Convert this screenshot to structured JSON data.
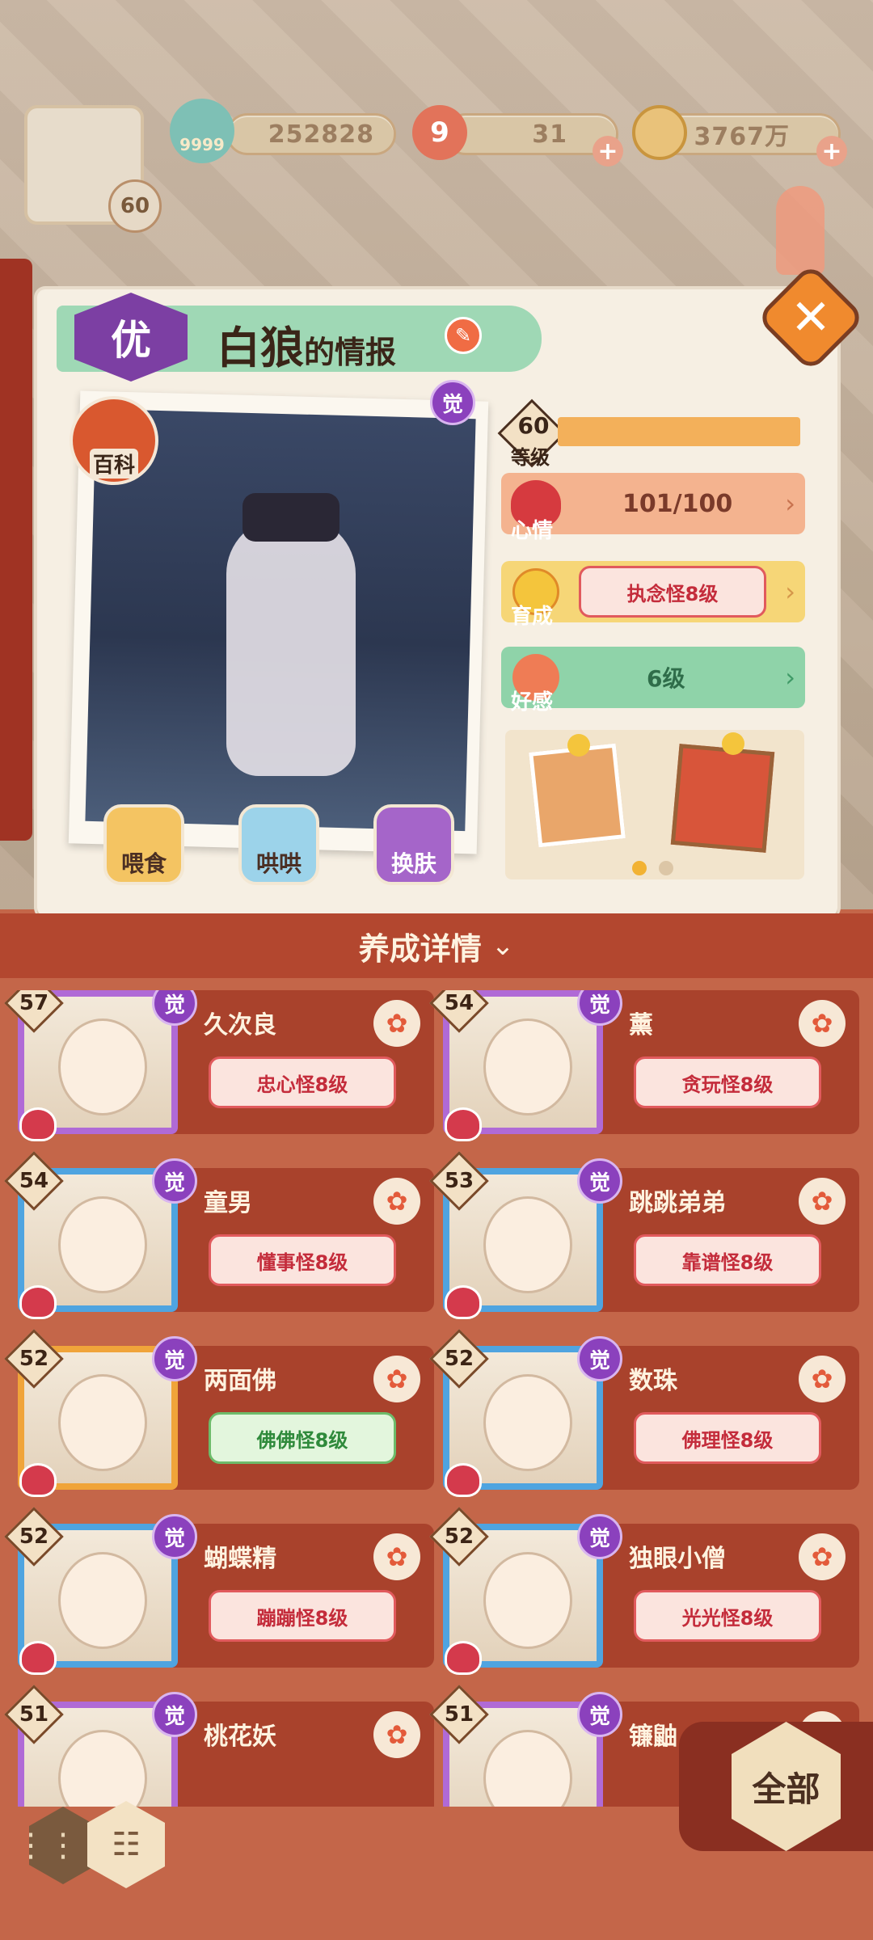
{
  "topbar": {
    "avatar_level": "60",
    "stamina_count": "9999",
    "gold": "252828",
    "gem_icon_number": "9",
    "gems": "31",
    "coins": "3767万"
  },
  "info": {
    "grade": "优",
    "name": "白狼",
    "suffix": "的情报",
    "wiki_label": "百科",
    "awake_badge": "觉",
    "level_value": "60",
    "level_label": "等级",
    "mood_label": "心情",
    "mood_value": "101/100",
    "growth_label": "育成",
    "growth_value": "执念怪8级",
    "favor_label": "好感",
    "favor_value": "6级",
    "actions": {
      "feed": "喂食",
      "coax": "哄哄",
      "skin": "换肤"
    }
  },
  "section_title": "养成详情",
  "cards": [
    {
      "level": "57",
      "name": "久次良",
      "tag": "忠心怪8级",
      "awake": "觉",
      "frame": "purple",
      "tag_style": "red"
    },
    {
      "level": "54",
      "name": "薰",
      "tag": "贪玩怪8级",
      "awake": "觉",
      "frame": "purple",
      "tag_style": "red"
    },
    {
      "level": "54",
      "name": "童男",
      "tag": "懂事怪8级",
      "awake": "觉",
      "frame": "blue",
      "tag_style": "red"
    },
    {
      "level": "53",
      "name": "跳跳弟弟",
      "tag": "靠谱怪8级",
      "awake": "觉",
      "frame": "blue",
      "tag_style": "red"
    },
    {
      "level": "52",
      "name": "两面佛",
      "tag": "佛佛怪8级",
      "awake": "觉",
      "frame": "orange",
      "tag_style": "green"
    },
    {
      "level": "52",
      "name": "数珠",
      "tag": "佛理怪8级",
      "awake": "觉",
      "frame": "blue",
      "tag_style": "red"
    },
    {
      "level": "52",
      "name": "蝴蝶精",
      "tag": "蹦蹦怪8级",
      "awake": "觉",
      "frame": "blue",
      "tag_style": "red"
    },
    {
      "level": "52",
      "name": "独眼小僧",
      "tag": "光光怪8级",
      "awake": "觉",
      "frame": "blue",
      "tag_style": "red"
    },
    {
      "level": "51",
      "name": "桃花妖",
      "tag": "",
      "awake": "觉",
      "frame": "purple",
      "tag_style": "red"
    },
    {
      "level": "51",
      "name": "镰鼬",
      "tag": "",
      "awake": "觉",
      "frame": "purple",
      "tag_style": "red"
    }
  ],
  "filter_button": "全部",
  "colors": {
    "panel": "#f6efe3",
    "bottom": "#c46649",
    "card": "#a9422c",
    "purple": "#8b41bd",
    "blue": "#4fa4e0",
    "orange": "#f0a43a"
  }
}
